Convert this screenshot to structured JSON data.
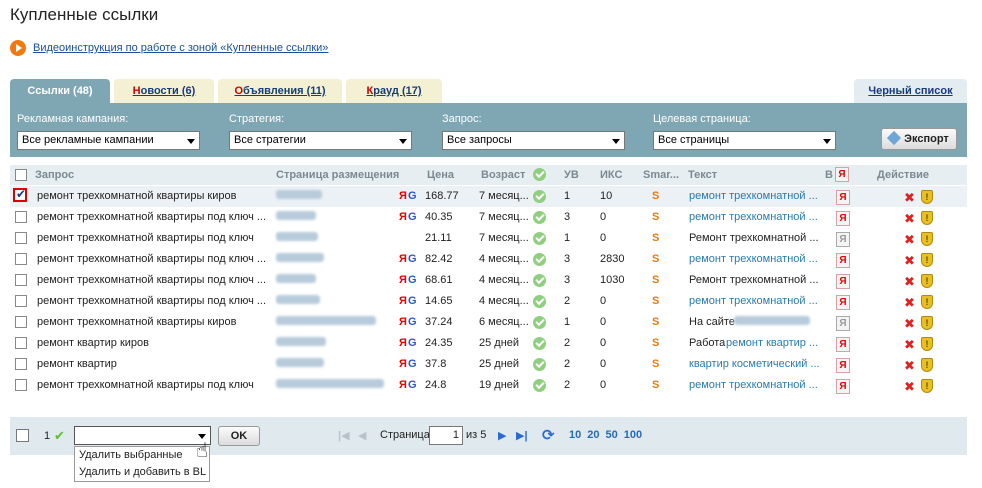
{
  "page": {
    "title": "Купленные ссылки",
    "video_link": "Видеоинструкция по работе с зоной «Купленные ссылки»"
  },
  "tabs": [
    {
      "first": "С",
      "rest": "сылки (48)"
    },
    {
      "first": "Н",
      "rest": "овости (6)"
    },
    {
      "first": "О",
      "rest": "бъявления (11)"
    },
    {
      "first": "К",
      "rest": "рауд (17)"
    }
  ],
  "blacklist_tab": "Черный список",
  "filters": {
    "campaign_label": "Рекламная кампания:",
    "campaign_value": "Все рекламные кампании",
    "strategy_label": "Стратегия:",
    "strategy_value": "Все стратегии",
    "query_label": "Запрос:",
    "query_value": "Все запросы",
    "target_label": "Целевая страница:",
    "target_value": "Все страницы",
    "export_label": "Экспорт"
  },
  "columns": {
    "query": "Запрос",
    "page": "Страница размещения",
    "price": "Цена",
    "age": "Возраст",
    "uv": "УВ",
    "iks": "ИКС",
    "smart": "Smar...",
    "text": "Текст",
    "in_index": "В",
    "ya_icon": "Я",
    "action": "Действие"
  },
  "rows": [
    {
      "query": "ремонт трехкомнатной квартиры киров",
      "yg": true,
      "price": "168.77",
      "age": "7 месяц...",
      "uv": "1",
      "iks": "10",
      "text_prefix": "",
      "text": "ремонт трехкомнатной ...",
      "text_is_link": true,
      "yred": true,
      "checked": true
    },
    {
      "query": "ремонт трехкомнатной квартиры под ключ ...",
      "yg": true,
      "price": "40.35",
      "age": "7 месяц...",
      "uv": "3",
      "iks": "0",
      "text_prefix": "",
      "text": "ремонт трехкомнатной ...",
      "text_is_link": true,
      "yred": true,
      "checked": false
    },
    {
      "query": "ремонт трехкомнатной квартиры под ключ",
      "yg": false,
      "price": "21.11",
      "age": "7 месяц...",
      "uv": "1",
      "iks": "0",
      "text_prefix": "",
      "text": "Ремонт трехкомнатной ...",
      "text_is_link": false,
      "yred": false,
      "checked": false
    },
    {
      "query": "ремонт трехкомнатной квартиры под ключ ...",
      "yg": true,
      "price": "82.42",
      "age": "4 месяц...",
      "uv": "3",
      "iks": "2830",
      "text_prefix": "",
      "text": "ремонт трехкомнатной ...",
      "text_is_link": true,
      "yred": true,
      "checked": false
    },
    {
      "query": "ремонт трехкомнатной квартиры под ключ ...",
      "yg": true,
      "price": "68.61",
      "age": "4 месяц...",
      "uv": "3",
      "iks": "1030",
      "text_prefix": "",
      "text": "Ремонт трехкомнатной ...",
      "text_is_link": false,
      "yred": true,
      "checked": false
    },
    {
      "query": "ремонт трехкомнатной квартиры под ключ ...",
      "yg": true,
      "price": "14.65",
      "age": "4 месяц...",
      "uv": "2",
      "iks": "0",
      "text_prefix": "",
      "text": "ремонт трехкомнатной ...",
      "text_is_link": true,
      "yred": true,
      "checked": false
    },
    {
      "query": "ремонт трехкомнатной квартиры киров",
      "yg": true,
      "price": "37.24",
      "age": "6 месяц...",
      "uv": "1",
      "iks": "0",
      "text_prefix": "На сайте",
      "text": "",
      "text_is_link": false,
      "yred": false,
      "checked": false
    },
    {
      "query": "ремонт квартир киров",
      "yg": true,
      "price": "24.35",
      "age": "25 дней",
      "uv": "2",
      "iks": "0",
      "text_prefix": "Работа",
      "text": "ремонт квартир ...",
      "text_is_link": true,
      "yred": true,
      "checked": false
    },
    {
      "query": "ремонт квартир",
      "yg": true,
      "price": "37.8",
      "age": "25 дней",
      "uv": "2",
      "iks": "0",
      "text_prefix": "",
      "text": "квартир косметический ...",
      "text_is_link": true,
      "yred": true,
      "checked": false
    },
    {
      "query": "ремонт трехкомнатной квартиры под ключ",
      "yg": true,
      "price": "24.8",
      "age": "19 дней",
      "uv": "2",
      "iks": "0",
      "text_prefix": "",
      "text": "ремонт трехкомнатной ...",
      "text_is_link": true,
      "yred": true,
      "checked": false
    }
  ],
  "marks": {
    "ya": "Я",
    "g": "G",
    "smart": "S",
    "x": "✖",
    "shield": "!"
  },
  "footer": {
    "selected_count": "1",
    "ok_label": "OK",
    "page_label": "Страница",
    "page_value": "1",
    "of_label": "из 5",
    "sizes": [
      "10",
      "20",
      "50",
      "100"
    ]
  },
  "dropdown": [
    "Удалить выбранные",
    "Удалить и добавить в BL"
  ],
  "colors": {
    "accent": "#7fa7b3",
    "tab_inactive": "#f4f0d4",
    "link": "#2a7ab0",
    "yandex": "#e00000"
  }
}
